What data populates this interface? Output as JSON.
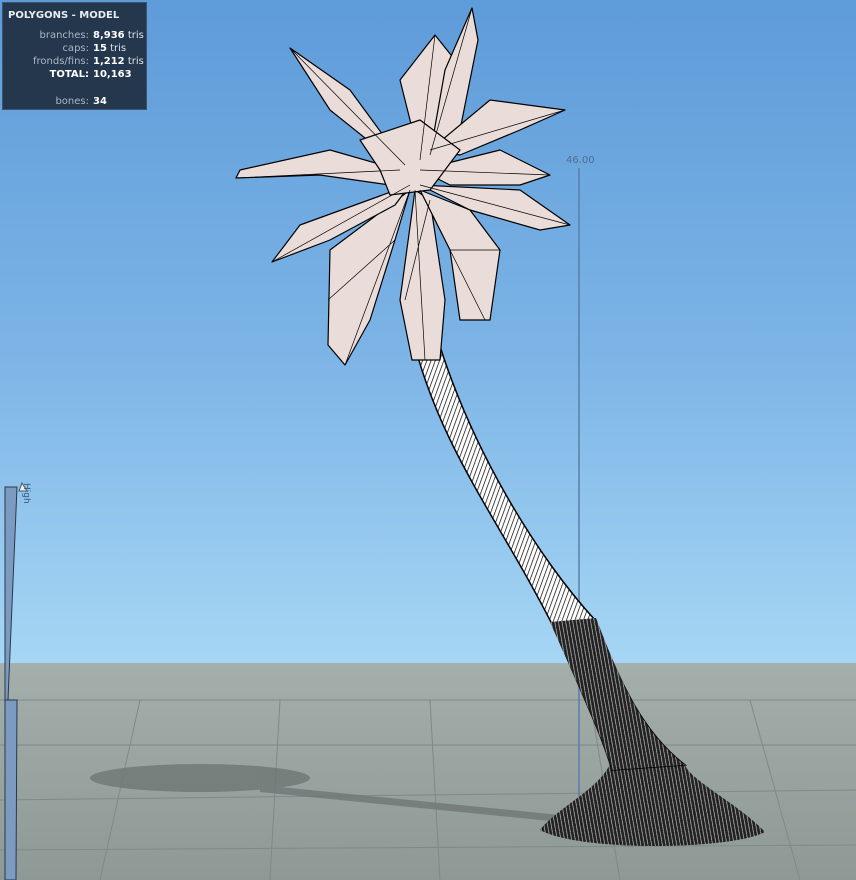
{
  "stats_panel": {
    "title": "POLYGONS - MODEL",
    "rows": [
      {
        "label": "branches:",
        "value": "8,936",
        "unit": "tris"
      },
      {
        "label": "caps:",
        "value": "15",
        "unit": "tris"
      },
      {
        "label": "fronds/fins:",
        "value": "1,212",
        "unit": "tris"
      },
      {
        "label": "TOTAL:",
        "value": "10,163",
        "unit": ""
      },
      {
        "label": "bones:",
        "value": "34",
        "unit": ""
      }
    ]
  },
  "height_ruler": {
    "label": "46.00"
  },
  "lod_slider": {
    "label": "High"
  },
  "colors": {
    "sky_top": "#5e9bd9",
    "horizon": "#a6d6f4",
    "ground": "#8e9996",
    "frond_fill": "#eadcd8",
    "panel_bg": "#24374d"
  }
}
